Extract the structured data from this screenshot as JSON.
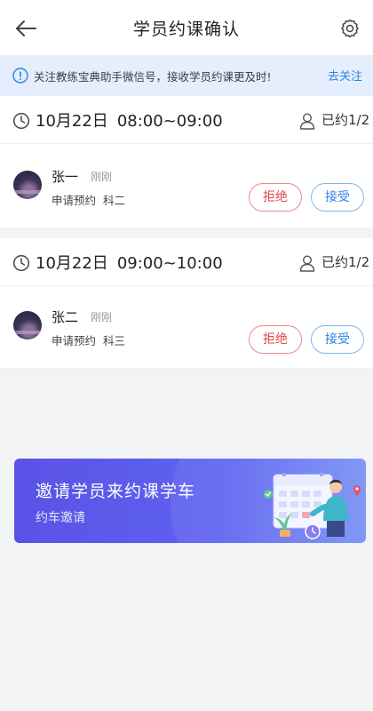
{
  "header": {
    "title": "学员约课确认",
    "back_icon": "arrow-left-icon",
    "settings_icon": "gear-icon"
  },
  "notice": {
    "icon": "info-icon",
    "text": "关注教练宝典助手微信号，接收学员约课更及时!",
    "link": "去关注"
  },
  "slots": [
    {
      "date": "10月22日",
      "time_range": "08:00~09:00",
      "booked": "已约1/2",
      "students": [
        {
          "name": "张一",
          "time": "刚刚",
          "request": "申请预约",
          "subject": "科二",
          "reject": "拒绝",
          "accept": "接受"
        }
      ]
    },
    {
      "date": "10月22日",
      "time_range": "09:00~10:00",
      "booked": "已约1/2",
      "students": [
        {
          "name": "张二",
          "time": "刚刚",
          "request": "申请预约",
          "subject": "科三",
          "reject": "拒绝",
          "accept": "接受"
        }
      ]
    }
  ],
  "banner": {
    "title": "邀请学员来约课学车",
    "subtitle": "约车邀请"
  },
  "colors": {
    "accent": "#2b83e8",
    "reject": "#e0474c",
    "banner": "#5a52e6",
    "notice_bg": "#e4eefc"
  }
}
